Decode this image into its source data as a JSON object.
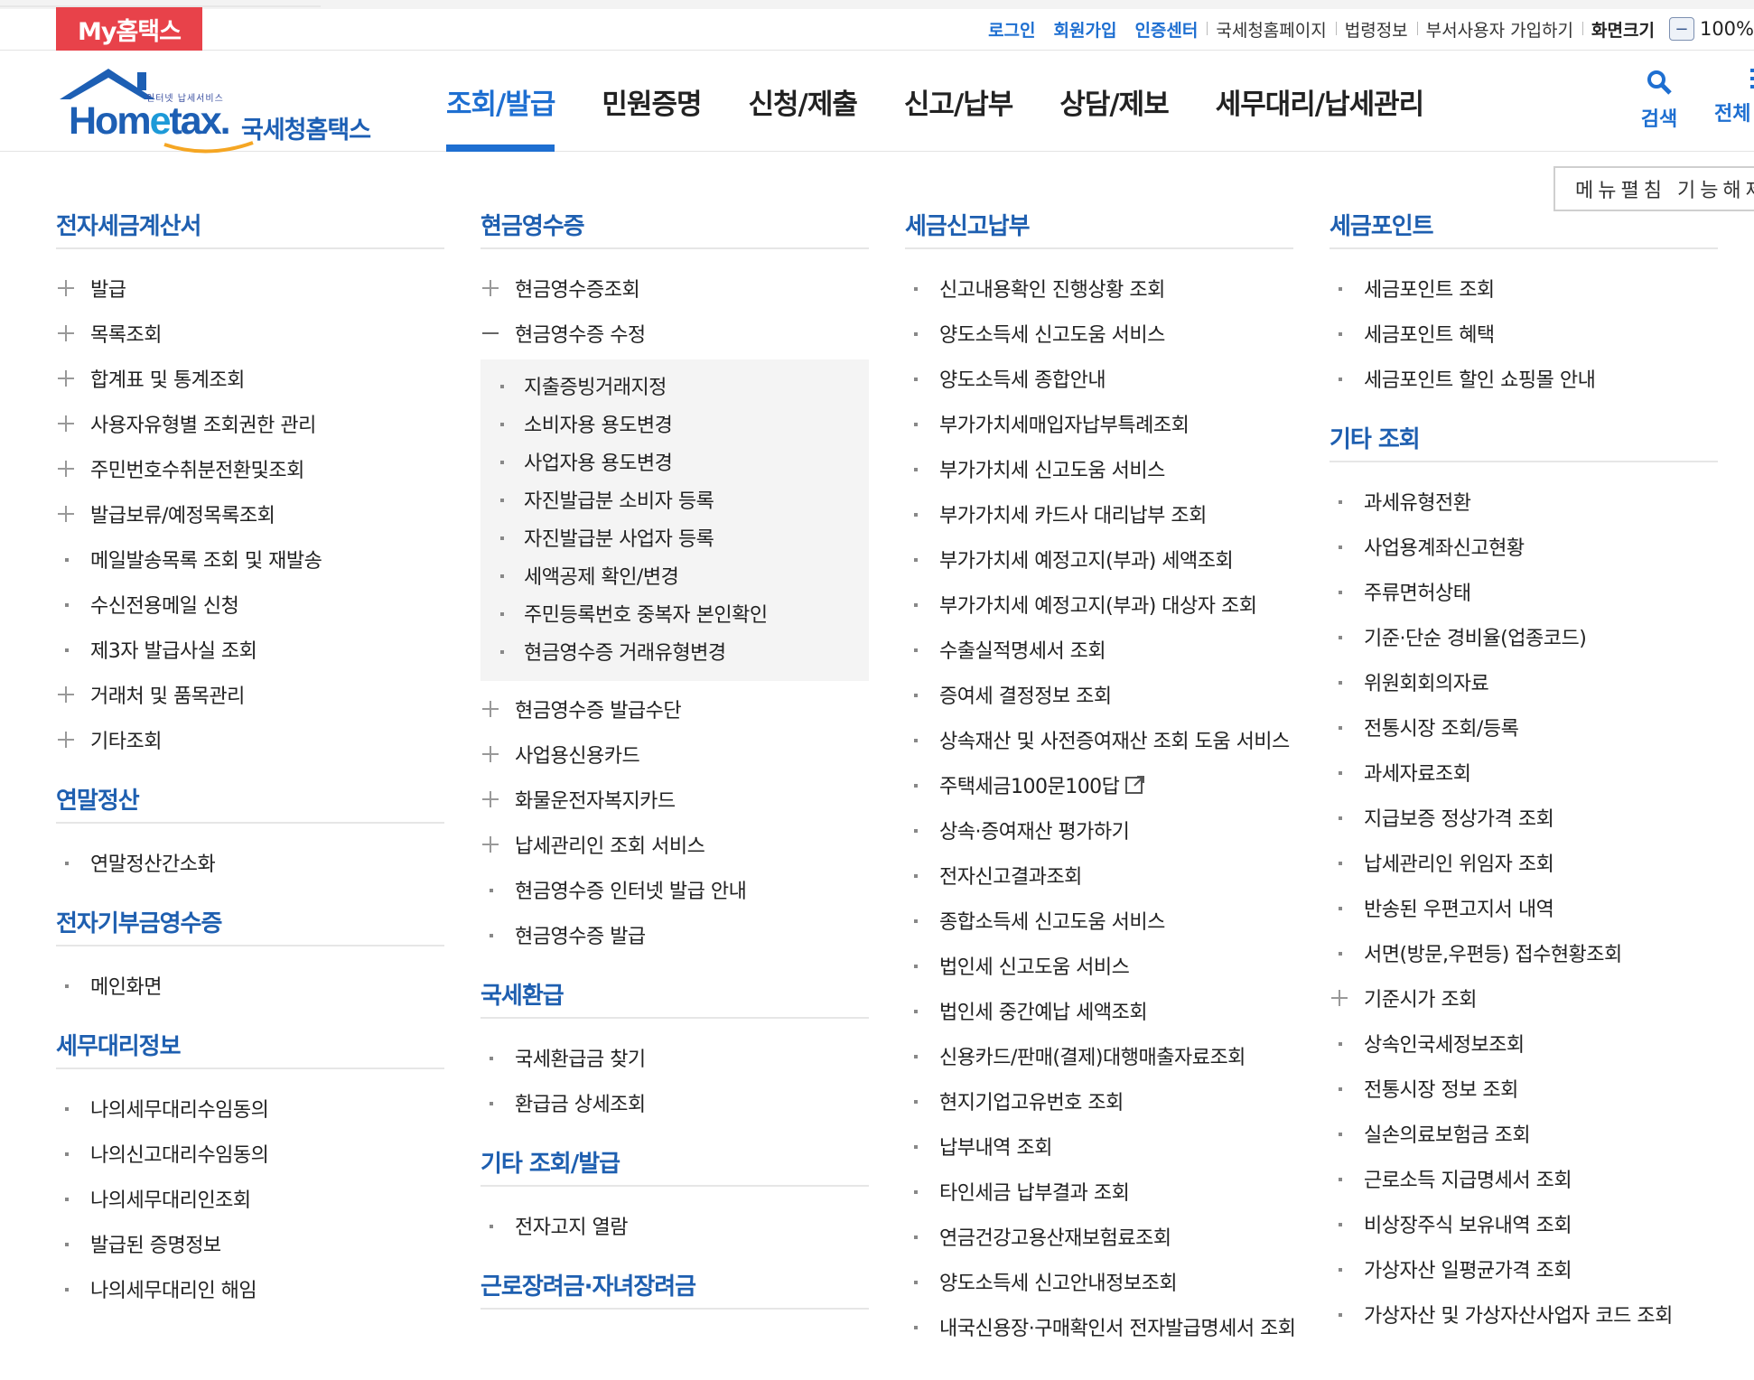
{
  "topbar": {
    "my_label": "My홈택스",
    "links": [
      {
        "label": "로그인",
        "style": "blue"
      },
      {
        "label": "회원가입",
        "style": "blue"
      },
      {
        "label": "인증센터",
        "style": "blue"
      },
      {
        "label": "국세청홈페이지",
        "style": "plain"
      },
      {
        "label": "법령정보",
        "style": "plain"
      },
      {
        "label": "부서사용자 가입하기",
        "style": "plain"
      },
      {
        "label": "화면크기",
        "style": "dark"
      }
    ],
    "zoom_value": "100%"
  },
  "logo": {
    "small_text": "인터넷 납세서비스",
    "main_pre": "Hom",
    "main_e": "e",
    "main_post": "tax.",
    "kr_text": "국세청홈택스"
  },
  "nav": {
    "items": [
      "조회/발급",
      "민원증명",
      "신청/제출",
      "신고/납부",
      "상담/제보",
      "세무대리/납세관리"
    ],
    "active_index": 0,
    "search_label": "검색",
    "all_label": "전체"
  },
  "toggle_label": "메뉴펼침 기능해제",
  "colors": {
    "accent": "#1e6fd1",
    "title": "#1e5fb0",
    "my_button": "#e8424a"
  },
  "columns": [
    {
      "sections": [
        {
          "title": "전자세금계산서",
          "items": [
            {
              "label": "발급",
              "marker": "plus"
            },
            {
              "label": "목록조회",
              "marker": "plus"
            },
            {
              "label": "합계표 및 통계조회",
              "marker": "plus"
            },
            {
              "label": "사용자유형별 조회권한 관리",
              "marker": "plus"
            },
            {
              "label": "주민번호수취분전환및조회",
              "marker": "plus"
            },
            {
              "label": "발급보류/예정목록조회",
              "marker": "plus"
            },
            {
              "label": "메일발송목록 조회 및 재발송",
              "marker": "dot"
            },
            {
              "label": "수신전용메일 신청",
              "marker": "dot"
            },
            {
              "label": "제3자 발급사실 조회",
              "marker": "dot"
            },
            {
              "label": "거래처 및 품목관리",
              "marker": "plus"
            },
            {
              "label": "기타조회",
              "marker": "plus"
            }
          ]
        },
        {
          "title": "연말정산",
          "items": [
            {
              "label": "연말정산간소화",
              "marker": "dot"
            }
          ]
        },
        {
          "title": "전자기부금영수증",
          "items": [
            {
              "label": "메인화면",
              "marker": "dot"
            }
          ]
        },
        {
          "title": "세무대리정보",
          "items": [
            {
              "label": "나의세무대리수임동의",
              "marker": "dot"
            },
            {
              "label": "나의신고대리수임동의",
              "marker": "dot"
            },
            {
              "label": "나의세무대리인조회",
              "marker": "dot"
            },
            {
              "label": "발급된 증명정보",
              "marker": "dot"
            },
            {
              "label": "나의세무대리인 해임",
              "marker": "dot"
            }
          ]
        }
      ]
    },
    {
      "sections": [
        {
          "title": "현금영수증",
          "items": [
            {
              "label": "현금영수증조회",
              "marker": "plus"
            },
            {
              "label": "현금영수증 수정",
              "marker": "minus",
              "children": [
                "지출증빙거래지정",
                "소비자용 용도변경",
                "사업자용 용도변경",
                "자진발급분 소비자 등록",
                "자진발급분 사업자 등록",
                "세액공제 확인/변경",
                "주민등록번호 중복자 본인확인",
                "현금영수증 거래유형변경"
              ]
            },
            {
              "label": "현금영수증 발급수단",
              "marker": "plus"
            },
            {
              "label": "사업용신용카드",
              "marker": "plus"
            },
            {
              "label": "화물운전자복지카드",
              "marker": "plus"
            },
            {
              "label": "납세관리인 조회 서비스",
              "marker": "plus"
            },
            {
              "label": "현금영수증 인터넷 발급 안내",
              "marker": "dot"
            },
            {
              "label": "현금영수증 발급",
              "marker": "dot"
            }
          ]
        },
        {
          "title": "국세환급",
          "items": [
            {
              "label": "국세환급금 찾기",
              "marker": "dot"
            },
            {
              "label": "환급금 상세조회",
              "marker": "dot"
            }
          ]
        },
        {
          "title": "기타 조회/발급",
          "items": [
            {
              "label": "전자고지 열람",
              "marker": "dot"
            }
          ]
        },
        {
          "title": "근로장려금·자녀장려금",
          "items": []
        }
      ]
    },
    {
      "sections": [
        {
          "title": "세금신고납부",
          "items": [
            {
              "label": "신고내용확인 진행상황 조회",
              "marker": "dot"
            },
            {
              "label": "양도소득세 신고도움 서비스",
              "marker": "dot"
            },
            {
              "label": "양도소득세 종합안내",
              "marker": "dot"
            },
            {
              "label": "부가가치세매입자납부특례조회",
              "marker": "dot"
            },
            {
              "label": "부가가치세 신고도움 서비스",
              "marker": "dot"
            },
            {
              "label": "부가가치세 카드사 대리납부 조회",
              "marker": "dot"
            },
            {
              "label": "부가가치세 예정고지(부과) 세액조회",
              "marker": "dot"
            },
            {
              "label": "부가가치세 예정고지(부과) 대상자 조회",
              "marker": "dot"
            },
            {
              "label": "수출실적명세서 조회",
              "marker": "dot"
            },
            {
              "label": "증여세 결정정보 조회",
              "marker": "dot"
            },
            {
              "label": "상속재산 및 사전증여재산 조회 도움 서비스",
              "marker": "dot"
            },
            {
              "label": "주택세금100문100답",
              "marker": "dot",
              "external": true
            },
            {
              "label": "상속·증여재산 평가하기",
              "marker": "dot"
            },
            {
              "label": "전자신고결과조회",
              "marker": "dot"
            },
            {
              "label": "종합소득세 신고도움 서비스",
              "marker": "dot"
            },
            {
              "label": "법인세 신고도움 서비스",
              "marker": "dot"
            },
            {
              "label": "법인세 중간예납 세액조회",
              "marker": "dot"
            },
            {
              "label": "신용카드/판매(결제)대행매출자료조회",
              "marker": "dot"
            },
            {
              "label": "현지기업고유번호 조회",
              "marker": "dot"
            },
            {
              "label": "납부내역 조회",
              "marker": "dot"
            },
            {
              "label": "타인세금 납부결과 조회",
              "marker": "dot"
            },
            {
              "label": "연금건강고용산재보험료조회",
              "marker": "dot"
            },
            {
              "label": "양도소득세 신고안내정보조회",
              "marker": "dot"
            },
            {
              "label": "내국신용장·구매확인서 전자발급명세서 조회",
              "marker": "dot"
            }
          ]
        }
      ]
    },
    {
      "sections": [
        {
          "title": "세금포인트",
          "items": [
            {
              "label": "세금포인트 조회",
              "marker": "dot"
            },
            {
              "label": "세금포인트 혜택",
              "marker": "dot"
            },
            {
              "label": "세금포인트 할인 쇼핑몰 안내",
              "marker": "dot"
            }
          ]
        },
        {
          "title": "기타 조회",
          "items": [
            {
              "label": "과세유형전환",
              "marker": "dot"
            },
            {
              "label": "사업용계좌신고현황",
              "marker": "dot"
            },
            {
              "label": "주류면허상태",
              "marker": "dot"
            },
            {
              "label": "기준·단순 경비율(업종코드)",
              "marker": "dot"
            },
            {
              "label": "위원회회의자료",
              "marker": "dot"
            },
            {
              "label": "전통시장 조회/등록",
              "marker": "dot"
            },
            {
              "label": "과세자료조회",
              "marker": "dot"
            },
            {
              "label": "지급보증 정상가격 조회",
              "marker": "dot"
            },
            {
              "label": "납세관리인 위임자 조회",
              "marker": "dot"
            },
            {
              "label": "반송된 우편고지서 내역",
              "marker": "dot"
            },
            {
              "label": "서면(방문,우편등) 접수현황조회",
              "marker": "dot"
            },
            {
              "label": "기준시가 조회",
              "marker": "plus"
            },
            {
              "label": "상속인국세정보조회",
              "marker": "dot"
            },
            {
              "label": "전통시장 정보 조회",
              "marker": "dot"
            },
            {
              "label": "실손의료보험금 조회",
              "marker": "dot"
            },
            {
              "label": "근로소득 지급명세서 조회",
              "marker": "dot"
            },
            {
              "label": "비상장주식 보유내역 조회",
              "marker": "dot"
            },
            {
              "label": "가상자산 일평균가격 조회",
              "marker": "dot"
            },
            {
              "label": "가상자산 및 가상자산사업자 코드 조회",
              "marker": "dot"
            }
          ]
        }
      ]
    }
  ]
}
